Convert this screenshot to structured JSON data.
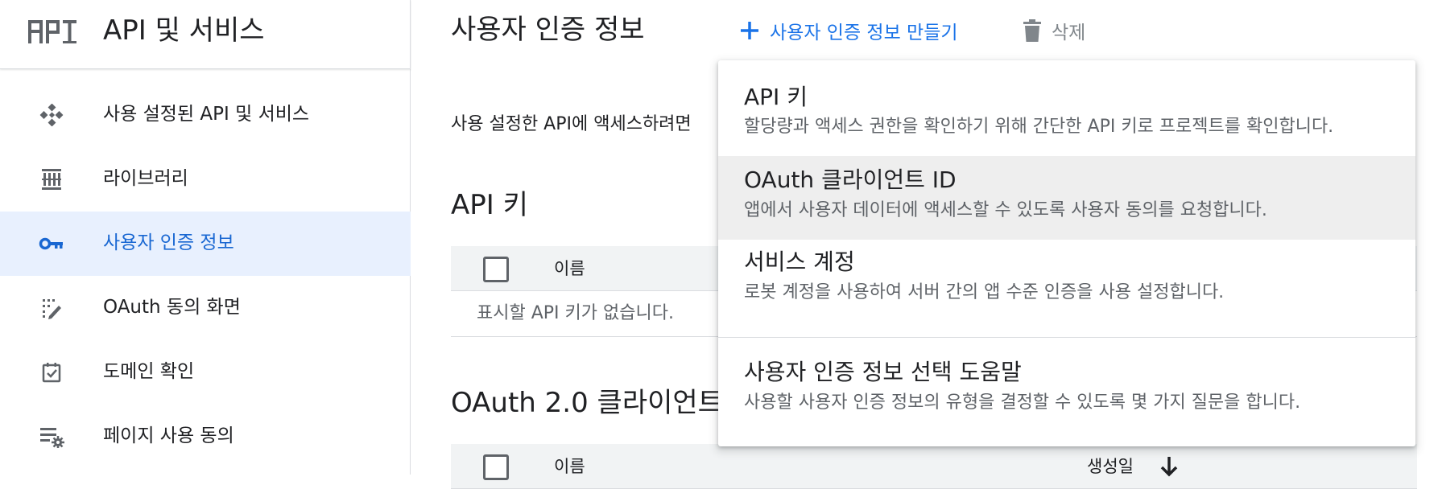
{
  "sidebar": {
    "product_title": "API 및 서비스",
    "items": [
      {
        "label": "사용 설정된 API 및 서비스",
        "icon": "api-hub-icon"
      },
      {
        "label": "라이브러리",
        "icon": "library-icon"
      },
      {
        "label": "사용자 인증 정보",
        "icon": "key-icon",
        "active": true
      },
      {
        "label": "OAuth 동의 화면",
        "icon": "consent-screen-icon"
      },
      {
        "label": "도메인 확인",
        "icon": "domain-verify-icon"
      },
      {
        "label": "페이지 사용 동의",
        "icon": "page-usage-settings-icon"
      }
    ]
  },
  "header": {
    "page_title": "사용자 인증 정보",
    "create_label": "사용자 인증 정보 만들기",
    "delete_label": "삭제"
  },
  "main": {
    "intro_text": "사용 설정한 API에 액세스하려면",
    "api_keys": {
      "title": "API 키",
      "column_name": "이름",
      "empty_text": "표시할 API 키가 없습니다."
    },
    "oauth_clients": {
      "title": "OAuth 2.0 클라이언트",
      "column_name": "이름",
      "column_created": "생성일"
    }
  },
  "create_menu": {
    "items": [
      {
        "title": "API 키",
        "description": "할당량과 액세스 권한을 확인하기 위해 간단한 API 키로 프로젝트를 확인합니다."
      },
      {
        "title": "OAuth 클라이언트 ID",
        "description": "앱에서 사용자 데이터에 액세스할 수 있도록 사용자 동의를 요청합니다.",
        "hovered": true
      },
      {
        "title": "서비스 계정",
        "description": "로봇 계정을 사용하여 서버 간의 앱 수준 인증을 사용 설정합니다."
      },
      {
        "title": "사용자 인증 정보 선택 도움말",
        "description": "사용할 사용자 인증 정보의 유형을 결정할 수 있도록 몇 가지 질문을 합니다."
      }
    ]
  },
  "colors": {
    "accent": "#1a73e8",
    "active_nav_bg": "#e8f0fe",
    "active_nav_text": "#1967d2",
    "menu_hover_bg": "#eeeeee"
  }
}
